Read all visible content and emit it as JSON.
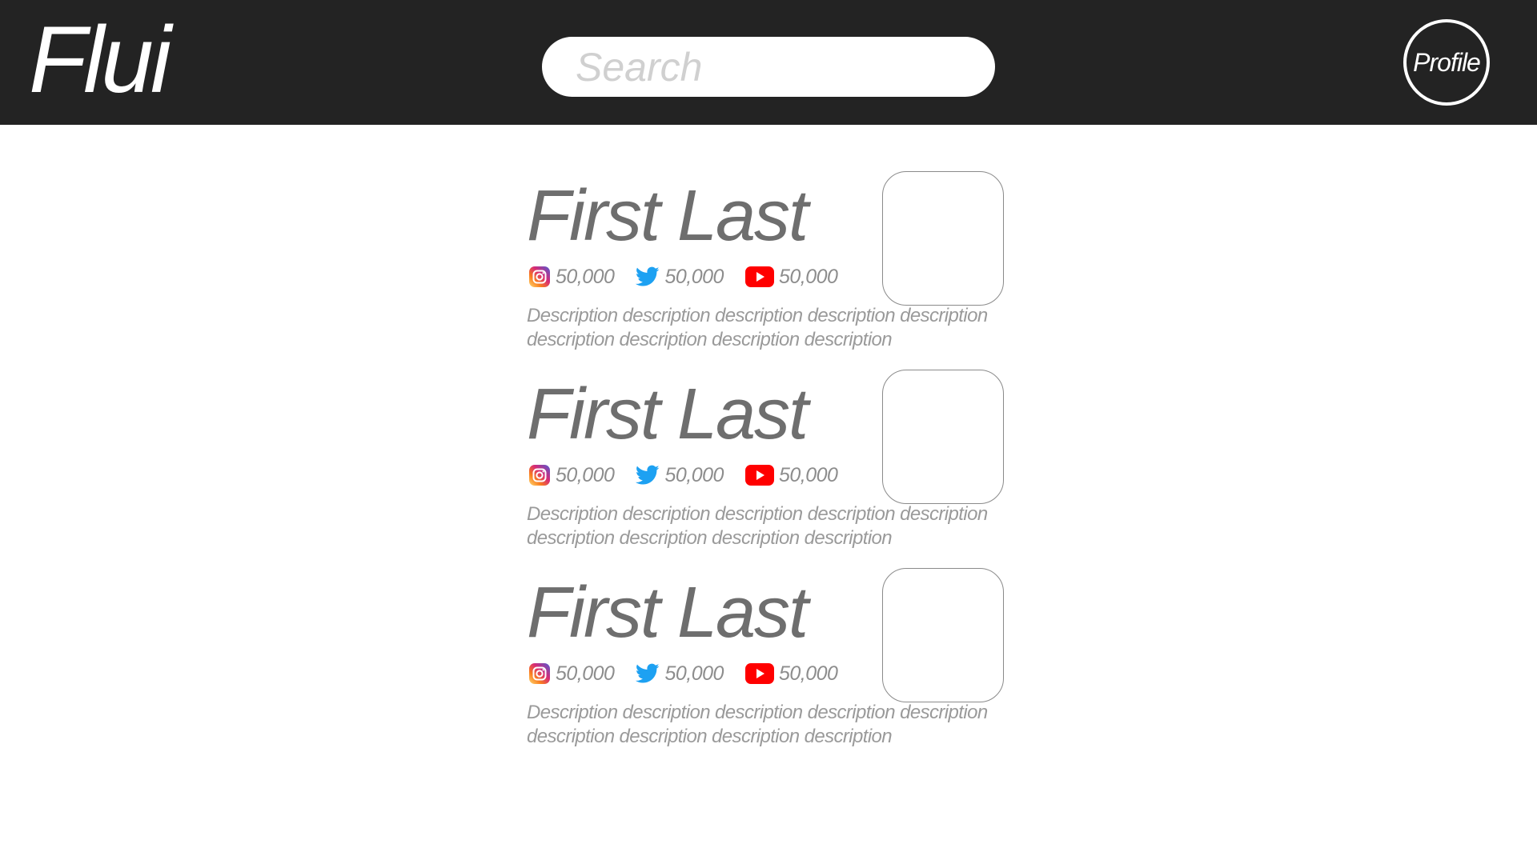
{
  "header": {
    "logo": "Flui",
    "search_placeholder": "Search",
    "profile_label": "Profile"
  },
  "icons": {
    "instagram": "instagram-icon",
    "twitter": "twitter-icon",
    "youtube": "youtube-icon"
  },
  "colors": {
    "header_bg": "#232323",
    "twitter_blue": "#1DA1F2",
    "youtube_red": "#FF0000"
  },
  "cards": [
    {
      "name": "First Last",
      "instagram": "50,000",
      "twitter": "50,000",
      "youtube": "50,000",
      "description": "Description description description description description description description description description"
    },
    {
      "name": "First Last",
      "instagram": "50,000",
      "twitter": "50,000",
      "youtube": "50,000",
      "description": "Description description description description description description description description description"
    },
    {
      "name": "First Last",
      "instagram": "50,000",
      "twitter": "50,000",
      "youtube": "50,000",
      "description": "Description description description description description description description description description"
    }
  ]
}
